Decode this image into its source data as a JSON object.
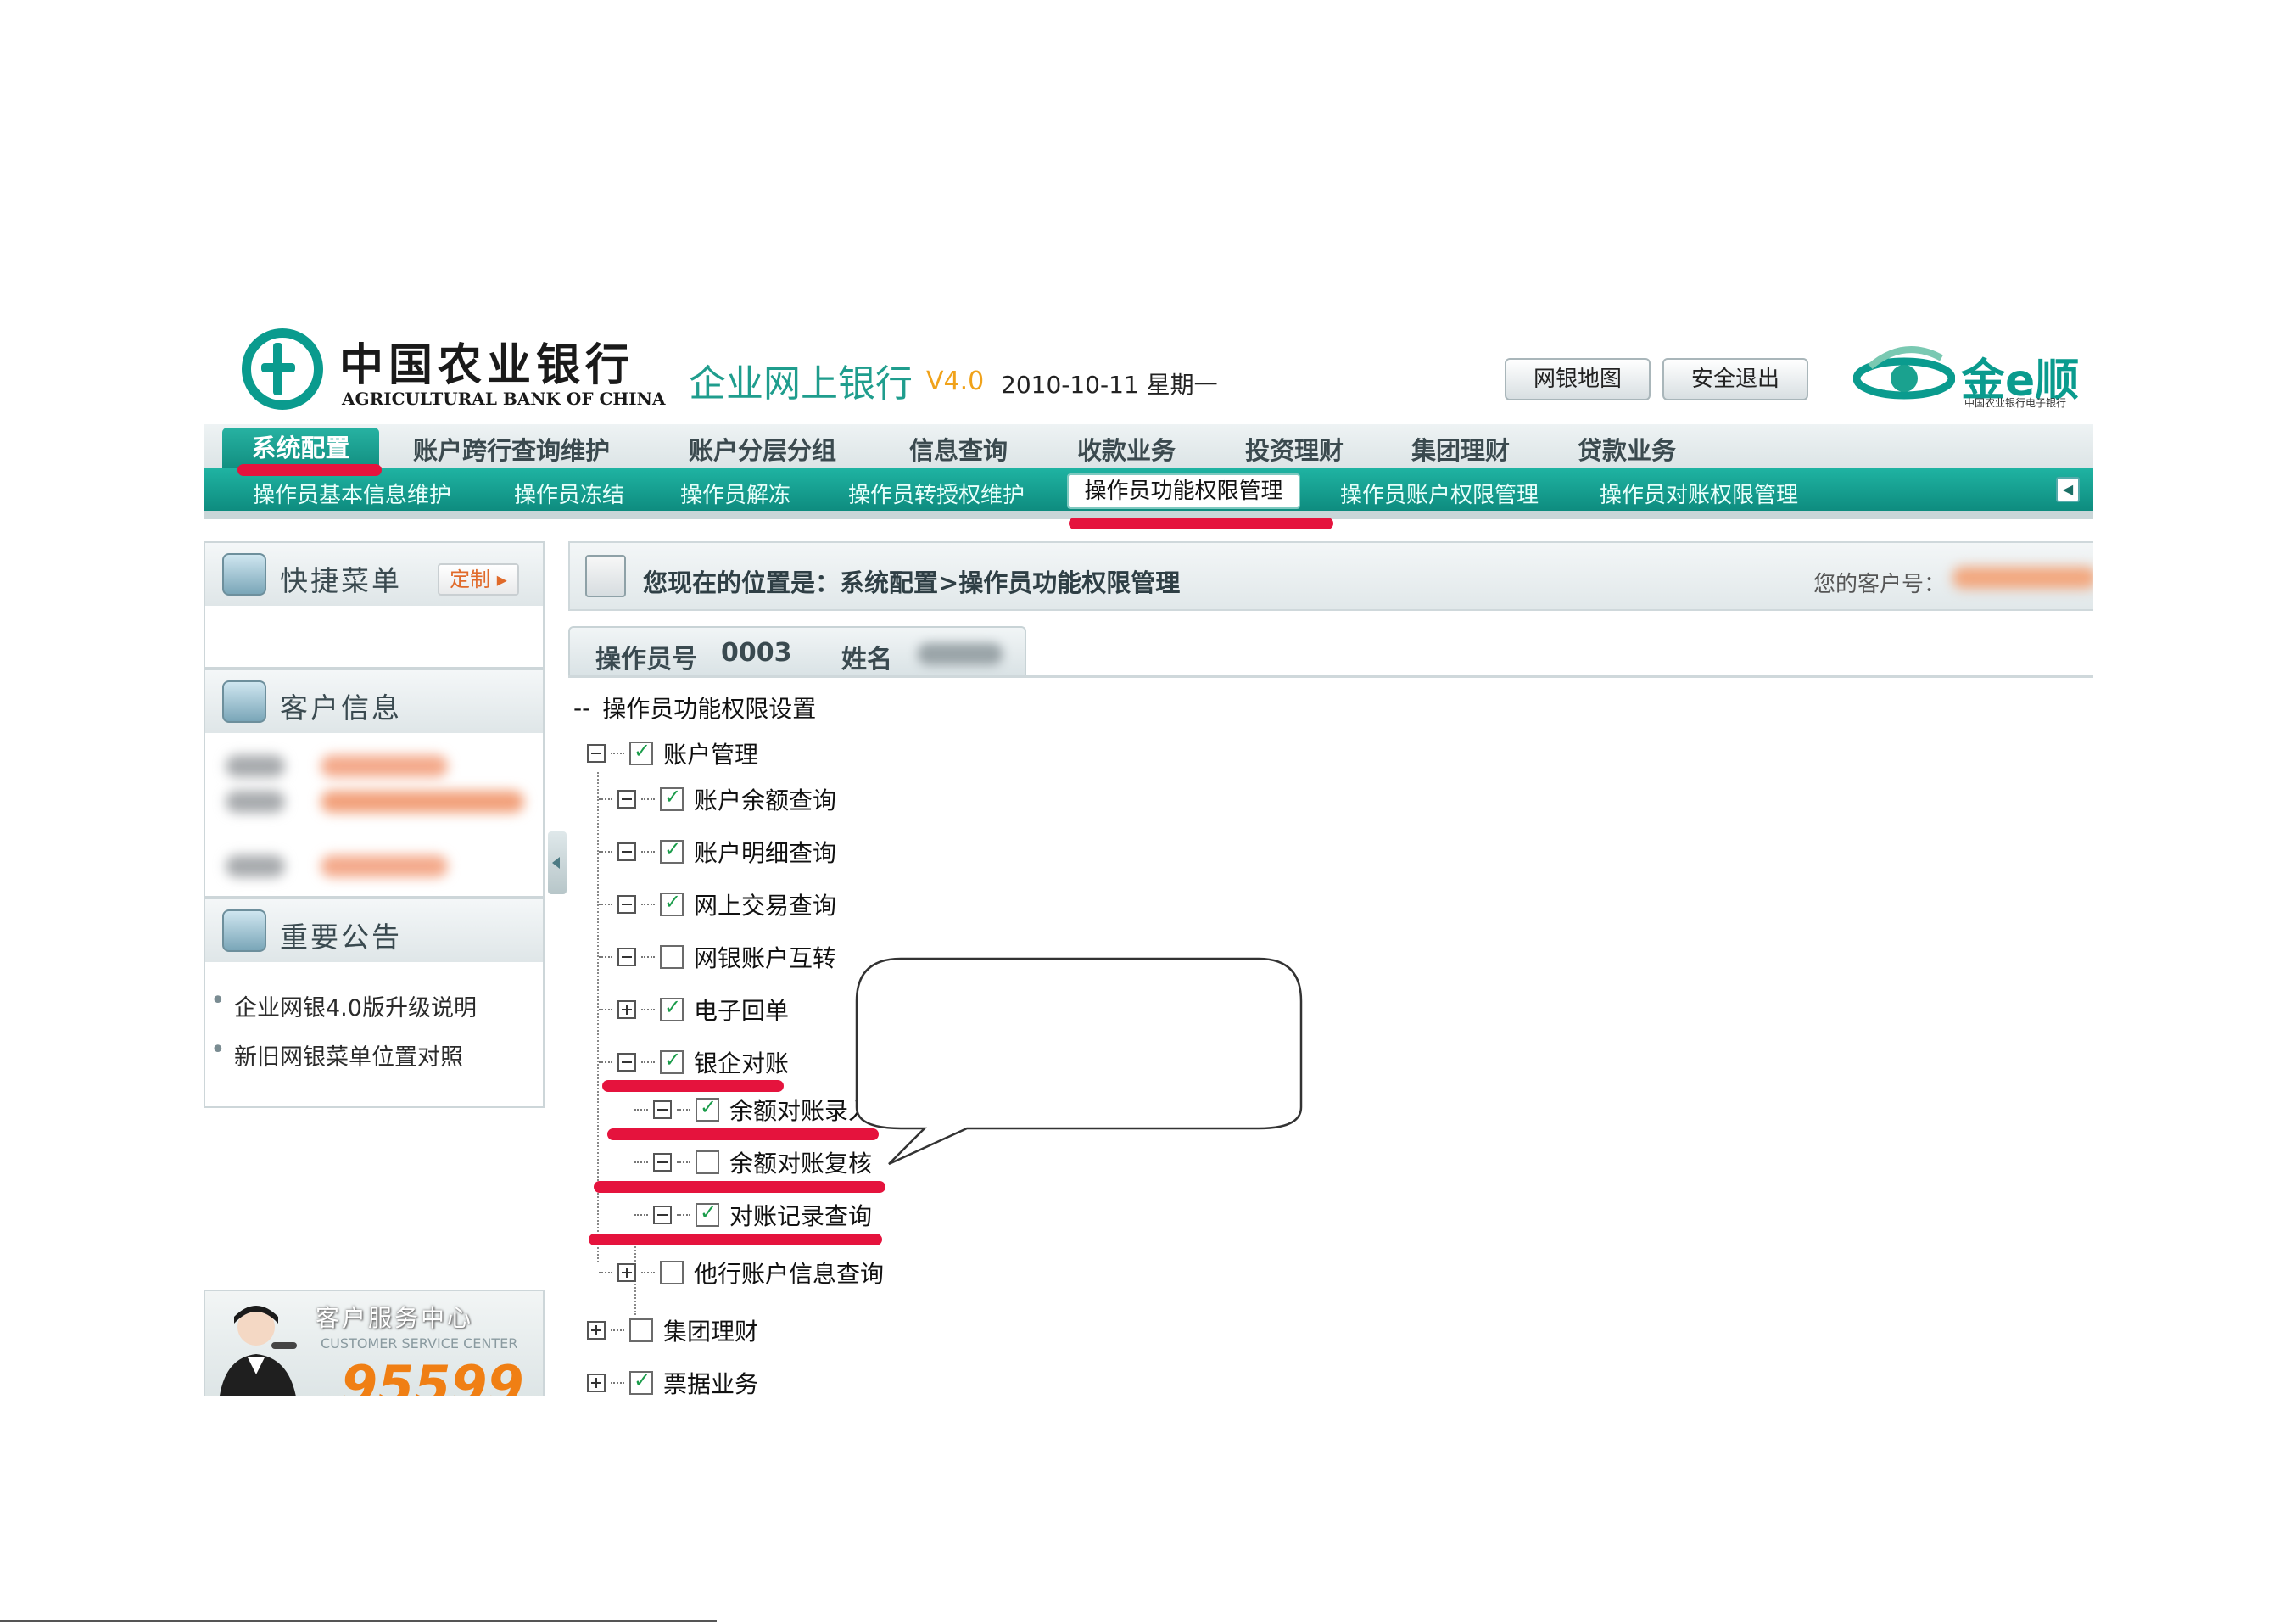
{
  "header": {
    "bank_name_cn": "中国农业银行",
    "bank_name_en": "AGRICULTURAL BANK OF CHINA",
    "product": "企业网上银行",
    "version": "V4.0",
    "date": "2010-10-11 星期一",
    "sitemap_button": "网银地图",
    "logout_button": "安全退出",
    "brand": "金e顺",
    "brand_sub": "中国农业银行电子银行"
  },
  "main_menu": {
    "active": "系统配置",
    "items": [
      "账户跨行查询维护",
      "账户分层分组",
      "信息查询",
      "收款业务",
      "投资理财",
      "集团理财",
      "贷款业务"
    ]
  },
  "sub_menu": {
    "items": [
      "操作员基本信息维护",
      "操作员冻结",
      "操作员解冻",
      "操作员转授权维护"
    ],
    "active": "操作员功能权限管理",
    "items_after": [
      "操作员账户权限管理",
      "操作员对账权限管理"
    ]
  },
  "sidebar": {
    "quick_menu": {
      "title": "快捷菜单",
      "customize": "定制"
    },
    "customer_info": {
      "title": "客户信息"
    },
    "notices": {
      "title": "重要公告",
      "items": [
        "企业网银4.0版升级说明",
        "新旧网银菜单位置对照"
      ]
    },
    "service": {
      "title": "客户服务中心",
      "title_en": "CUSTOMER SERVICE CENTER",
      "phone": "95599"
    }
  },
  "location": {
    "text": "您现在的位置是：系统配置>操作员功能权限管理",
    "customer_no_label": "您的客户号："
  },
  "operator": {
    "label": "操作员号",
    "id": "0003",
    "name_label": "姓名"
  },
  "tree": {
    "root": "操作员功能权限设置",
    "nodes": [
      {
        "label": "账户管理",
        "checked": true,
        "expanded": true
      },
      {
        "label": "账户余额查询",
        "checked": true,
        "expanded": true
      },
      {
        "label": "账户明细查询",
        "checked": true,
        "expanded": true
      },
      {
        "label": "网上交易查询",
        "checked": true,
        "expanded": true
      },
      {
        "label": "网银账户互转",
        "checked": false,
        "expanded": true
      },
      {
        "label": "电子回单",
        "checked": true,
        "expanded": false
      },
      {
        "label": "银企对账",
        "checked": true,
        "expanded": true
      },
      {
        "label": "余额对账录入",
        "checked": true,
        "expanded": true
      },
      {
        "label": "余额对账复核",
        "checked": false,
        "expanded": true
      },
      {
        "label": "对账记录查询",
        "checked": true,
        "expanded": true
      },
      {
        "label": "他行账户信息查询",
        "checked": false,
        "expanded": false
      },
      {
        "label": "集团理财",
        "checked": false,
        "expanded": false
      },
      {
        "label": "票据业务",
        "checked": true,
        "expanded": false
      }
    ]
  },
  "colors": {
    "brand_teal": "#0a9b8e",
    "highlight_red": "#e5133d",
    "version_orange": "#f0a21a",
    "phone_orange": "#f07f14"
  }
}
